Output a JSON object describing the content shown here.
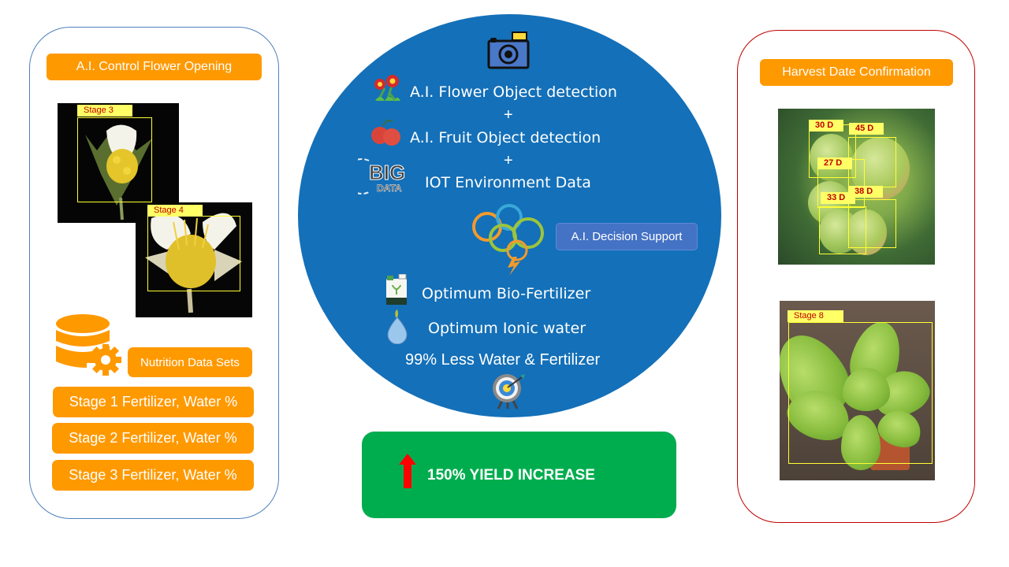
{
  "left_panel": {
    "title": "A.I. Control Flower Opening",
    "flower_images": [
      {
        "label": "Stage 3"
      },
      {
        "label": "Stage 4"
      }
    ],
    "nutrition_label": "Nutrition Data Sets",
    "stages": [
      "Stage 1 Fertilizer, Water %",
      "Stage 2 Fertilizer, Water %",
      "Stage 3 Fertilizer, Water %"
    ],
    "icons": [
      "database-gear-icon"
    ]
  },
  "center": {
    "icons": [
      "camera-icon",
      "flower-icon",
      "fruit-icon",
      "big-data-icon",
      "brain-icon",
      "fertilizer-bottle-icon",
      "water-drop-icon",
      "target-icon"
    ],
    "big_data_icon_text": {
      "top": "BIG",
      "bottom": "DATA"
    },
    "lines": {
      "flower_detection": "A.I. Flower Object detection",
      "plus_1": "+",
      "fruit_detection": "A.I. Fruit Object detection",
      "plus_2": "+",
      "iot_data": "IOT Environment Data",
      "decision_support": "A.I. Decision Support",
      "bio_fertilizer": "Optimum Bio-Fertilizer",
      "ionic_water": "Optimum Ionic water",
      "savings": "99% Less Water & Fertilizer"
    },
    "colors": {
      "circle": "#1470b8",
      "decision_button": "#4472c4"
    }
  },
  "yield_box": {
    "text": "150% YIELD INCREASE",
    "icon": "up-arrow-icon",
    "colors": {
      "background": "#00ad4e",
      "arrow": "#ff0000"
    }
  },
  "right_panel": {
    "title": "Harvest Date Confirmation",
    "fruit_detections": [
      "30 D",
      "45 D",
      "27 D",
      "38 D",
      "33 D"
    ],
    "plant_detection": "Stage 8"
  },
  "colors": {
    "orange": "#ff9900",
    "left_border": "#4f81bd",
    "right_border": "#c00000",
    "label_bg": "#ffff66",
    "label_text": "#c00000"
  }
}
